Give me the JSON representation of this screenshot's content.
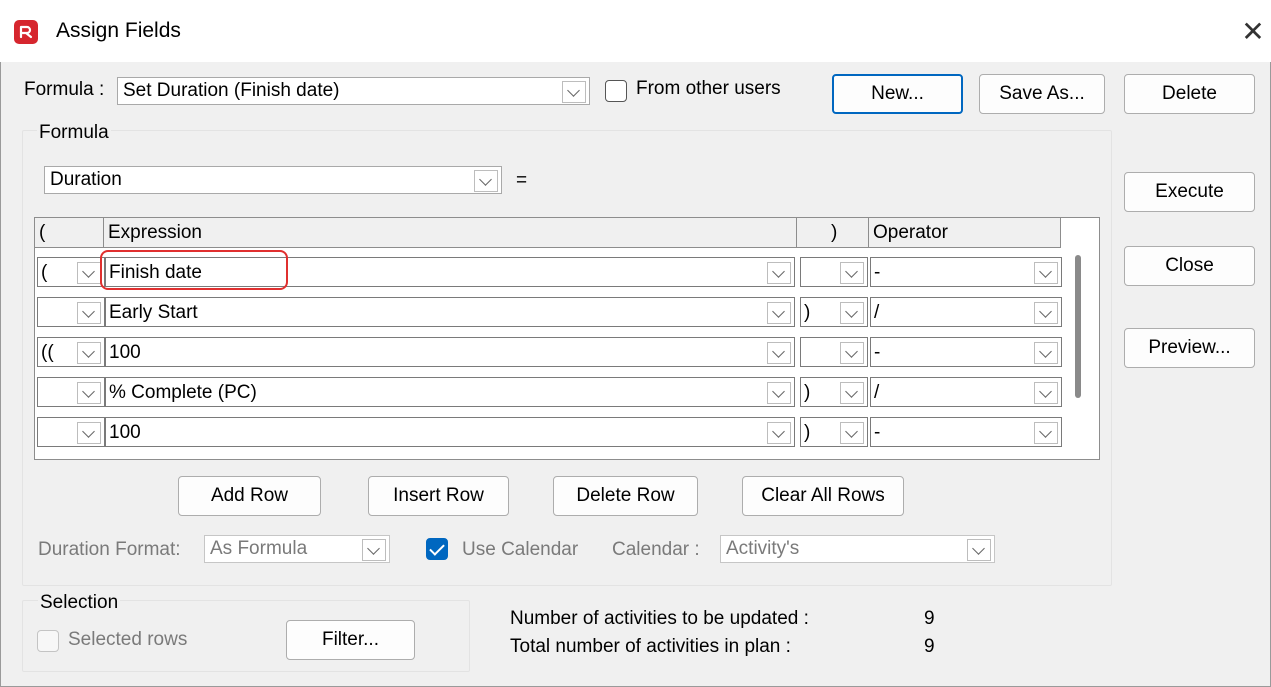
{
  "window": {
    "title": "Assign Fields",
    "close_glyph": "✕"
  },
  "formula_selector": {
    "label": "Formula :",
    "value": "Set Duration (Finish date)",
    "from_other_users_label": "From other users",
    "from_other_users_checked": false
  },
  "top_buttons": {
    "new": "New...",
    "save_as": "Save As...",
    "delete": "Delete"
  },
  "side_buttons": {
    "execute": "Execute",
    "close": "Close",
    "preview": "Preview..."
  },
  "formula_group": {
    "label": "Formula",
    "target_field": "Duration",
    "equals": "=",
    "columns": {
      "open_paren": "(",
      "expression": "Expression",
      "close_paren": ")",
      "operator": "Operator"
    },
    "rows": [
      {
        "open": "(",
        "expression": "Finish date",
        "close": "",
        "operator": "-"
      },
      {
        "open": "",
        "expression": "Early Start",
        "close": ")",
        "operator": "/"
      },
      {
        "open": "((",
        "expression": "100",
        "close": "",
        "operator": "-"
      },
      {
        "open": "",
        "expression": "% Complete (PC)",
        "close": ")",
        "operator": "/"
      },
      {
        "open": "",
        "expression": "100",
        "close": ")",
        "operator": "-"
      }
    ],
    "row_buttons": {
      "add": "Add Row",
      "insert": "Insert Row",
      "delete": "Delete Row",
      "clear": "Clear All Rows"
    },
    "duration_format_label": "Duration Format:",
    "duration_format_value": "As Formula",
    "use_calendar_label": "Use Calendar",
    "use_calendar_checked": true,
    "calendar_label": "Calendar :",
    "calendar_value": "Activity's"
  },
  "selection_group": {
    "label": "Selection",
    "selected_rows_label": "Selected rows",
    "filter_button": "Filter..."
  },
  "stats": {
    "to_update_label": "Number of activities to be updated :",
    "to_update_value": "9",
    "total_label": "Total number of activities in plan :",
    "total_value": "9"
  },
  "colors": {
    "accent": "#0067c0",
    "highlight": "#e0302f",
    "app_icon": "#d6262e"
  }
}
